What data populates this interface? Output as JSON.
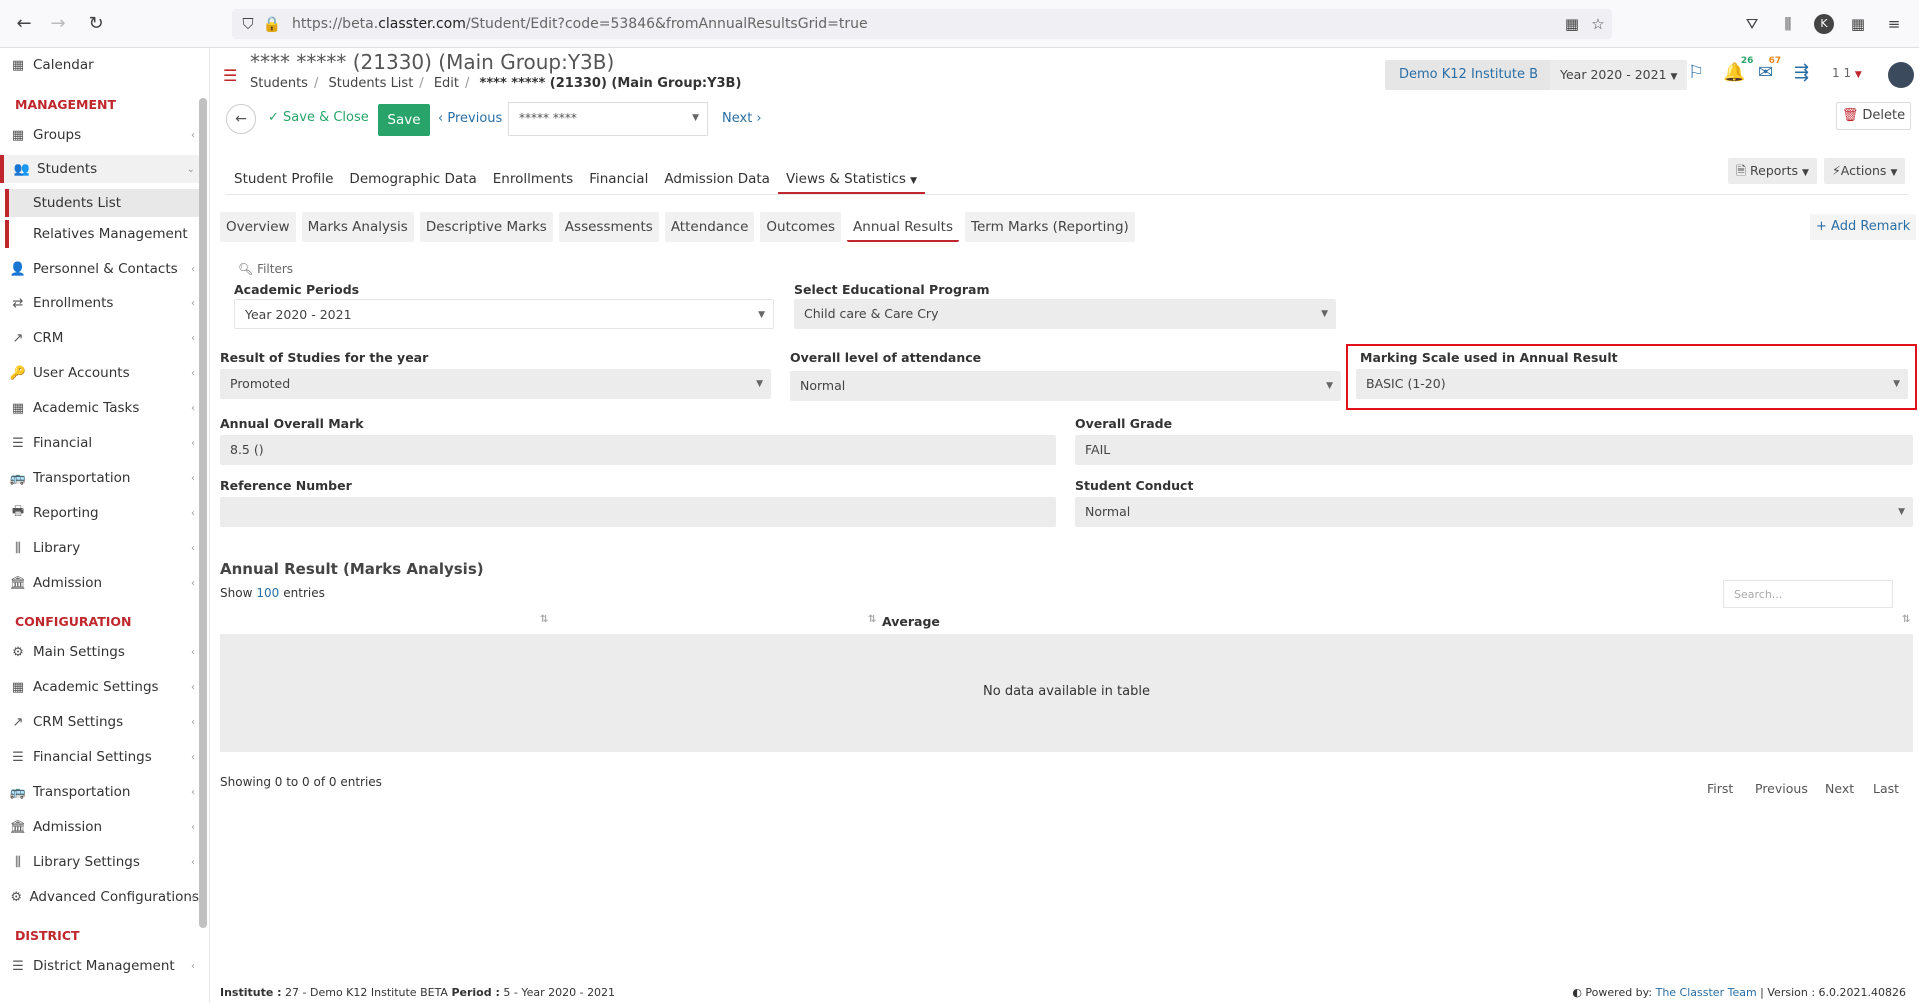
{
  "browser": {
    "url_prefix": "https://beta.",
    "url_domain": "classter.com",
    "url_path": "/Student/Edit?code=53846&fromAnnualResultsGrid=true"
  },
  "sidebar": {
    "items_top": [
      {
        "label": "Calendar",
        "icon": "calendar-icon"
      }
    ],
    "heading_management": "MANAGEMENT",
    "management_items": [
      {
        "label": "Groups",
        "icon": "groups-icon"
      },
      {
        "label": "Students",
        "icon": "students-icon"
      }
    ],
    "student_sub": [
      "Students List",
      "Relatives Management"
    ],
    "management_items_2": [
      {
        "label": "Personnel & Contacts",
        "icon": "personnel-icon"
      },
      {
        "label": "Enrollments",
        "icon": "enrollments-icon"
      },
      {
        "label": "CRM",
        "icon": "crm-icon"
      },
      {
        "label": "User Accounts",
        "icon": "user-accounts-icon"
      },
      {
        "label": "Academic Tasks",
        "icon": "academic-tasks-icon"
      },
      {
        "label": "Financial",
        "icon": "financial-icon"
      },
      {
        "label": "Transportation",
        "icon": "transportation-icon"
      },
      {
        "label": "Reporting",
        "icon": "reporting-icon"
      },
      {
        "label": "Library",
        "icon": "library-icon"
      },
      {
        "label": "Admission",
        "icon": "admission-icon"
      }
    ],
    "heading_configuration": "CONFIGURATION",
    "config_items": [
      {
        "label": "Main Settings",
        "icon": "main-settings-icon"
      },
      {
        "label": "Academic Settings",
        "icon": "academic-settings-icon"
      },
      {
        "label": "CRM Settings",
        "icon": "crm-settings-icon"
      },
      {
        "label": "Financial Settings",
        "icon": "financial-settings-icon"
      },
      {
        "label": "Transportation",
        "icon": "transportation-icon"
      },
      {
        "label": "Admission",
        "icon": "admission-icon"
      },
      {
        "label": "Library Settings",
        "icon": "library-settings-icon"
      },
      {
        "label": "Advanced Configurations",
        "icon": "advanced-config-icon"
      }
    ],
    "heading_district": "DISTRICT",
    "district_items": [
      {
        "label": "District Management",
        "icon": "district-icon"
      }
    ]
  },
  "header": {
    "title": "**** ***** (21330) (Main Group:Y3B)",
    "breadcrumb": [
      "Students",
      "Students List",
      "Edit"
    ],
    "breadcrumb_current": "**** ***** (21330) (Main Group:Y3B)",
    "institute": "Demo K12 Institute B",
    "year": "Year 2020 - 2021",
    "notif_count": "26",
    "mail_count": "67",
    "user_count": "1 1"
  },
  "toolbar": {
    "save_close": "Save & Close",
    "save": "Save",
    "previous": "Previous",
    "student_select": "***** ****",
    "next": "Next",
    "delete": "Delete"
  },
  "tabs": [
    "Student Profile",
    "Demographic Data",
    "Enrollments",
    "Financial",
    "Admission Data",
    "Views & Statistics"
  ],
  "tab_reports": "Reports",
  "tab_actions": "Actions",
  "subtabs": [
    "Overview",
    "Marks Analysis",
    "Descriptive Marks",
    "Assessments",
    "Attendance",
    "Outcomes",
    "Annual Results",
    "Term Marks (Reporting)"
  ],
  "add_remark": "Add Remark",
  "form": {
    "filters": "Filters",
    "academic_periods_label": "Academic Periods",
    "academic_periods_value": "Year 2020 - 2021",
    "edu_program_label": "Select Educational Program",
    "edu_program_value": "Child care & Care Cry",
    "result_label": "Result of Studies for the year",
    "result_value": "Promoted",
    "attendance_label": "Overall level of attendance",
    "attendance_value": "Normal",
    "marking_scale_label": "Marking Scale used in Annual Result",
    "marking_scale_value": "BASIC (1-20)",
    "overall_mark_label": "Annual Overall Mark",
    "overall_mark_value": "8.5 ()",
    "overall_grade_label": "Overall Grade",
    "overall_grade_value": "FAIL",
    "reference_label": "Reference Number",
    "reference_value": "",
    "conduct_label": "Student Conduct",
    "conduct_value": "Normal"
  },
  "table": {
    "title": "Annual Result (Marks Analysis)",
    "show": "Show",
    "entries_count": "100",
    "entries": "entries",
    "search_placeholder": "Search...",
    "col_average": "Average",
    "no_data": "No data available in table",
    "showing": "Showing 0 to 0 of 0 entries",
    "pager": [
      "First",
      "Previous",
      "Next",
      "Last"
    ]
  },
  "footer": {
    "institute_label": "Institute :",
    "institute_value": "27 - Demo K12 Institute BETA",
    "period_label": "Period :",
    "period_value": "5 - Year 2020 - 2021",
    "powered_by": "Powered by:",
    "team": "The Classter Team",
    "version": "| Version : 6.0.2021.40826"
  }
}
